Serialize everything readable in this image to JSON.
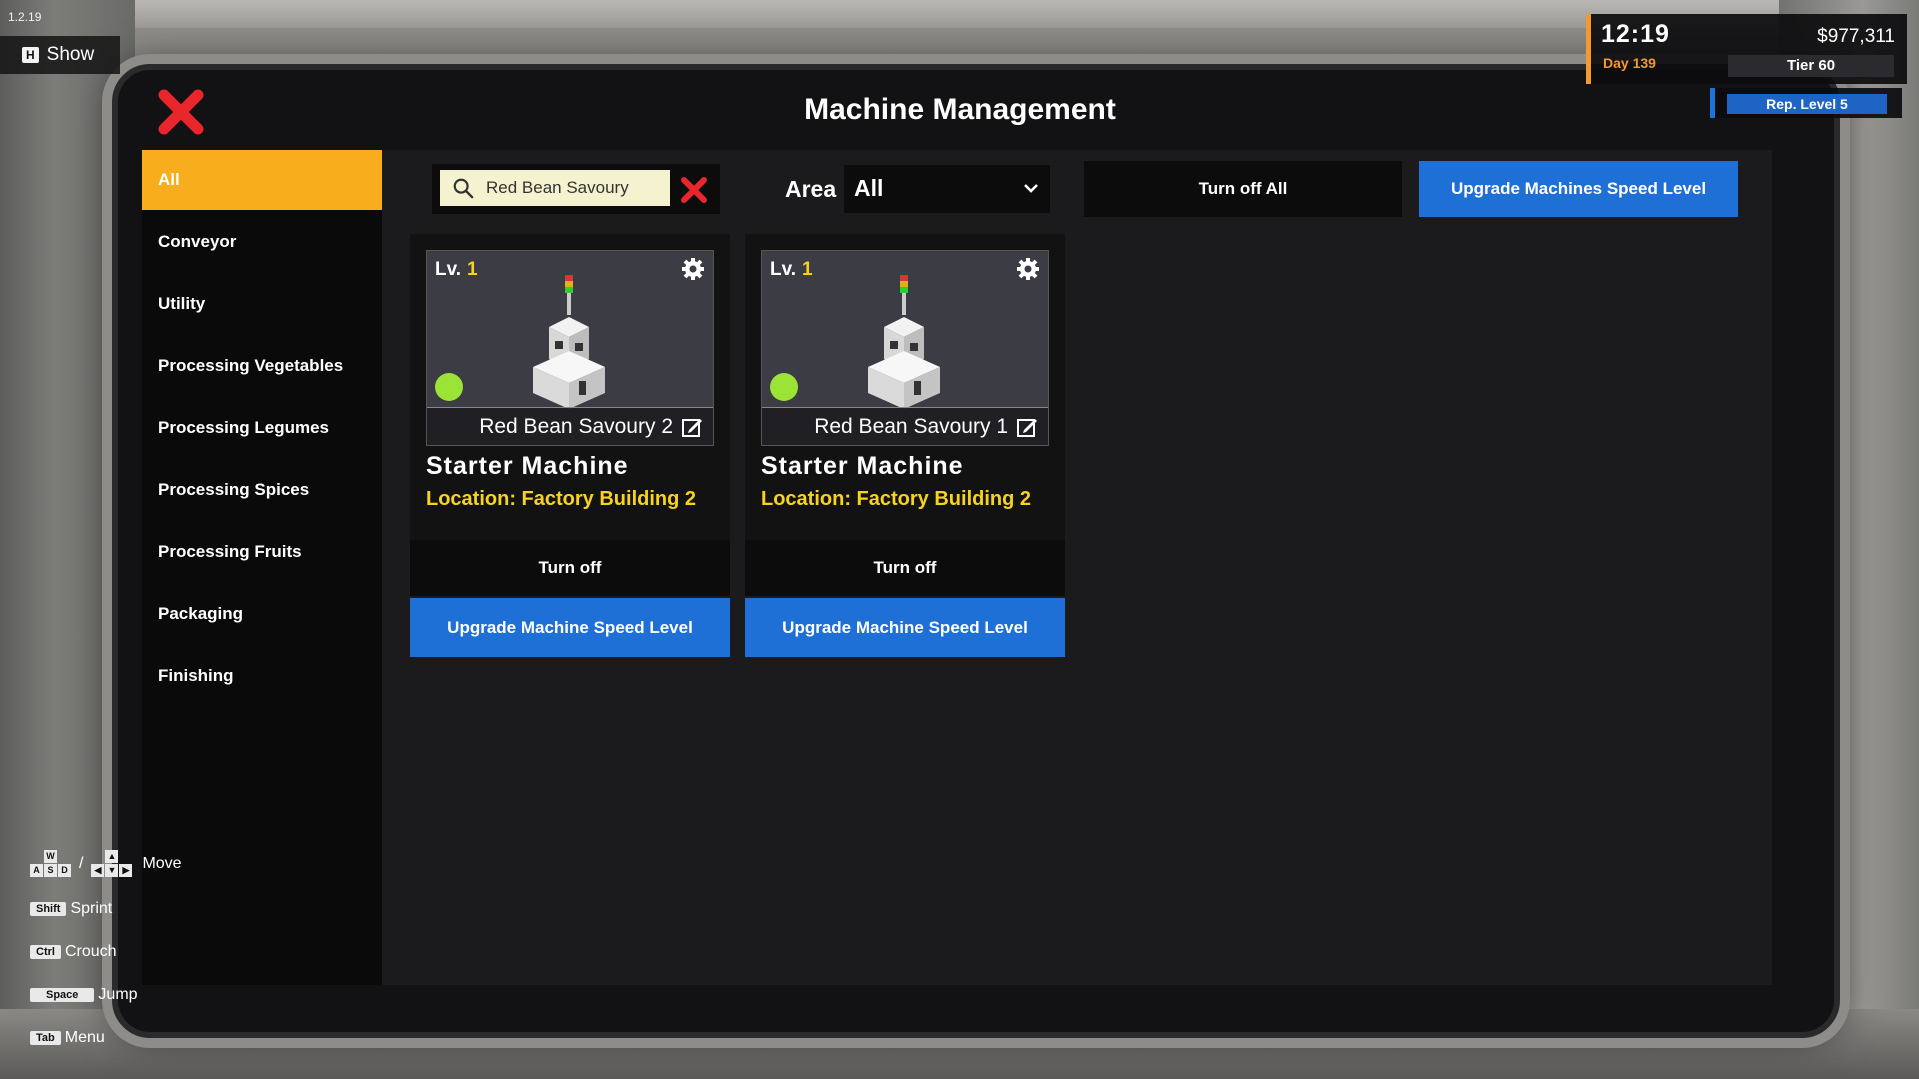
{
  "version": "1.2.19",
  "show_toggle": {
    "key": "H",
    "label": "Show"
  },
  "hud": {
    "time": "12:19",
    "day": "Day 139",
    "money": "$977,311",
    "tier": "Tier 60",
    "reputation": "Rep. Level 5"
  },
  "window": {
    "title": "Machine Management"
  },
  "categories": [
    {
      "label": "All",
      "active": true
    },
    {
      "label": "Conveyor"
    },
    {
      "label": "Utility"
    },
    {
      "label": "Processing Vegetables"
    },
    {
      "label": "Processing Legumes"
    },
    {
      "label": "Processing Spices"
    },
    {
      "label": "Processing Fruits"
    },
    {
      "label": "Packaging"
    },
    {
      "label": "Finishing"
    }
  ],
  "toolbar": {
    "search_value": "Red Bean Savoury",
    "area_label": "Area",
    "area_value": "All",
    "turn_off_all": "Turn off All",
    "upgrade_all": "Upgrade Machines Speed Level"
  },
  "machines": [
    {
      "level_label": "Lv.",
      "level": "1",
      "name": "Red Bean Savoury 2",
      "type": "Starter Machine",
      "location": "Location: Factory Building 2",
      "status_color": "#9be337",
      "turn_off": "Turn off",
      "upgrade": "Upgrade Machine Speed Level"
    },
    {
      "level_label": "Lv.",
      "level": "1",
      "name": "Red Bean Savoury 1",
      "type": "Starter Machine",
      "location": "Location: Factory Building 2",
      "status_color": "#9be337",
      "turn_off": "Turn off",
      "upgrade": "Upgrade Machine Speed Level"
    }
  ],
  "controls": {
    "move": {
      "keys": [
        "W",
        "A",
        "S",
        "D"
      ],
      "separator": "/",
      "label": "Move"
    },
    "sprint": {
      "key": "Shift",
      "label": "Sprint"
    },
    "crouch": {
      "key": "Ctrl",
      "label": "Crouch"
    },
    "jump": {
      "key": "Space",
      "label": "Jump"
    },
    "menu": {
      "key": "Tab",
      "label": "Menu"
    }
  },
  "colors": {
    "accent_orange": "#f8ad1c",
    "accent_yellow": "#f8d21c",
    "button_blue": "#1e6fd6",
    "close_red": "#e8262b"
  }
}
